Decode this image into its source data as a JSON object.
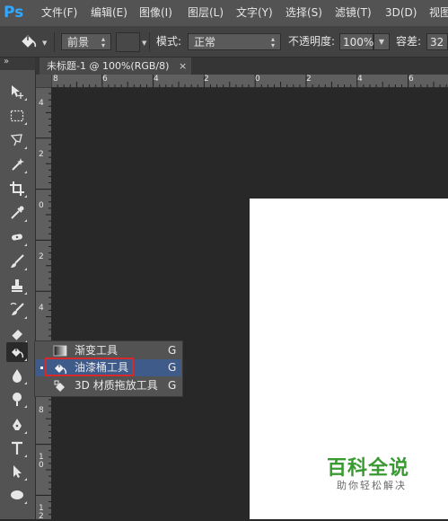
{
  "app": {
    "logo_text": "Ps",
    "logo_color": "#31a8ff"
  },
  "menu": [
    {
      "label": "文件(F)"
    },
    {
      "label": "编辑(E)"
    },
    {
      "label": "图像(I)"
    },
    {
      "label": "图层(L)"
    },
    {
      "label": "文字(Y)"
    },
    {
      "label": "选择(S)"
    },
    {
      "label": "滤镜(T)"
    },
    {
      "label": "3D(D)"
    },
    {
      "label": "视图"
    }
  ],
  "options": {
    "tool_icon": "paint-bucket-icon",
    "fill_source": "前景",
    "pattern_swatch": "",
    "mode_label": "模式:",
    "mode_value": "正常",
    "opacity_label": "不透明度:",
    "opacity_value": "100%",
    "tolerance_label": "容差:",
    "tolerance_value": "32"
  },
  "document_tab": {
    "title": "未标题-1 @ 100%(RGB/8)",
    "close": "×"
  },
  "rulers": {
    "top_labels": [
      "8",
      "6",
      "4",
      "2",
      "0",
      "2",
      "4",
      "6"
    ],
    "left_labels": [
      "4",
      "2",
      "0",
      "2",
      "4",
      "6",
      "8",
      "1\n0",
      "1\n2"
    ]
  },
  "toolbox": {
    "collapse_glyph": "»",
    "tools": [
      "move-tool-icon",
      "marquee-tool-icon",
      "lasso-tool-icon",
      "magic-wand-icon",
      "crop-tool-icon",
      "eyedropper-icon",
      "healing-brush-icon",
      "brush-tool-icon",
      "clone-stamp-icon",
      "history-brush-icon",
      "eraser-tool-icon",
      "paint-bucket-icon",
      "blur-tool-icon",
      "dodge-tool-icon",
      "pen-tool-icon",
      "type-tool-icon",
      "path-selection-icon",
      "ellipse-tool-icon"
    ],
    "active_tool": "paint-bucket-icon"
  },
  "flyout": {
    "items": [
      {
        "label": "渐变工具",
        "shortcut": "G",
        "icon": "gradient-icon",
        "selected": false
      },
      {
        "label": "油漆桶工具",
        "shortcut": "G",
        "icon": "paint-bucket-icon",
        "selected": true
      },
      {
        "label": "3D 材质拖放工具",
        "shortcut": "G",
        "icon": "3d-material-drop-icon",
        "selected": false
      }
    ],
    "highlight_color": "#d42a2a"
  },
  "watermark": {
    "title": "百科全说",
    "subtitle": "助你轻松解决",
    "color": "#3a9a32"
  }
}
